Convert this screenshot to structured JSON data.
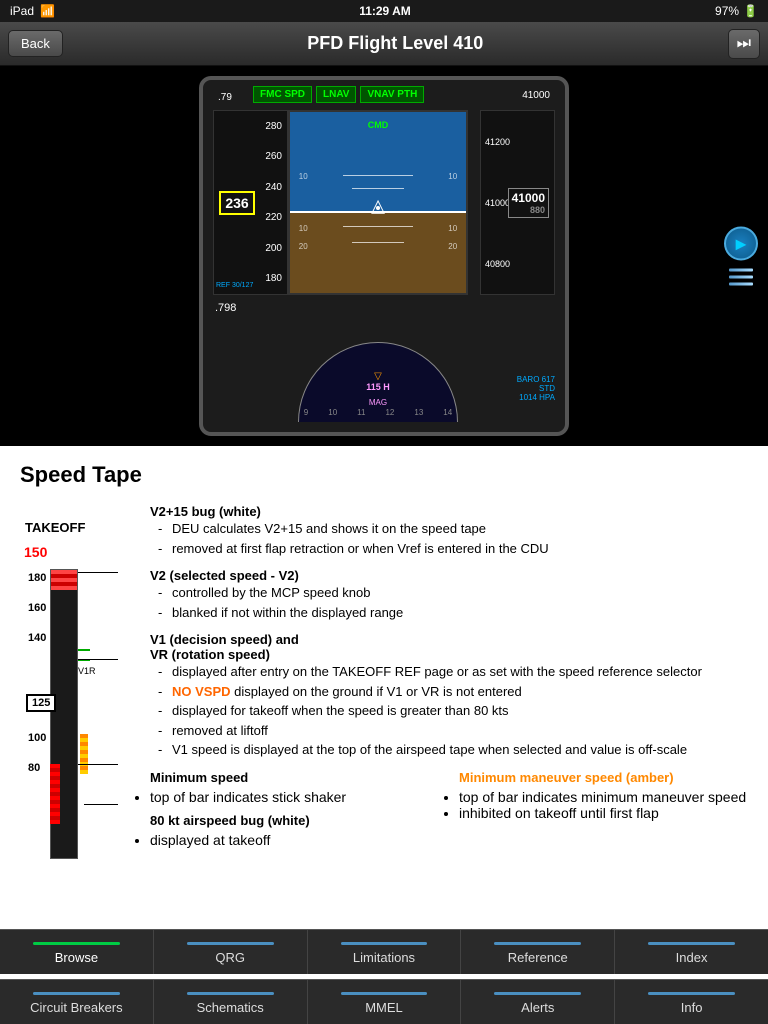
{
  "statusBar": {
    "device": "iPad",
    "wifi": "wifi",
    "time": "11:29 AM",
    "battery": "97%"
  },
  "navBar": {
    "backLabel": "Back",
    "title": "PFD Flight Level 410",
    "skipIcon": "⏭"
  },
  "pfd": {
    "modes": [
      "FMC SPD",
      "LNAV",
      "VNAV PTH"
    ],
    "cmd": "CMD",
    "speedCurrent": "236",
    "speedMach": ".798",
    "speedTop": ".79",
    "altCurrent": "41000",
    "altTarget": "41000",
    "alt41200": "41200",
    "alt40800": "40800",
    "refSpeed": "REF 30/127",
    "baro": "BARO 617",
    "std": "STD",
    "qnh": "1014 HPA",
    "heading": "115 H",
    "mag": "MAG",
    "speed180": "280",
    "speed260": "260",
    "speed240": "240",
    "speed220": "220",
    "speed200": "200",
    "speed180b": "180"
  },
  "content": {
    "sectionTitle": "Speed Tape",
    "takeoffLabel": "TAKEOFF",
    "speedValue": "150",
    "speedLabels": [
      "180",
      "160",
      "140",
      "125",
      "100",
      "80"
    ],
    "v1rLabel": "V1R",
    "blocks": [
      {
        "heading": "V2+15 bug (white)",
        "items": [
          "DEU calculates V2+15 and shows it on the speed tape",
          "removed at first flap retraction or when Vref is entered in the CDU"
        ]
      },
      {
        "heading": "V2 (selected speed - V2)",
        "items": [
          "controlled by the MCP speed knob",
          "blanked if not within the displayed range"
        ]
      },
      {
        "heading": "V1 (decision speed) and",
        "headingLine2": "VR (rotation speed)",
        "items": [
          "displayed after entry on the TAKEOFF REF page or as set with the speed reference selector",
          "NO VSPD displayed on the ground if V1 or VR is not entered",
          "displayed for takeoff when the speed is greater than 80 kts",
          "removed at liftoff",
          "V1 speed is displayed at the top of the airspeed tape when selected and value is off-scale"
        ],
        "hasNoVspd": true,
        "noVspdIndex": 1
      }
    ],
    "minSpeed": {
      "leftHeading": "Minimum speed",
      "leftItems": [
        "top of bar indicates stick shaker"
      ],
      "eightyk": "80 kt airspeed bug (white)",
      "eightykItems": [
        "displayed at takeoff"
      ],
      "rightHeading": "Minimum maneuver speed (amber)",
      "rightItems": [
        "top of bar indicates minimum maneuver speed",
        "inhibited on takeoff until first flap"
      ]
    }
  },
  "bottomNav1": {
    "tabs": [
      {
        "label": "Browse",
        "hasBar": true,
        "barColor": "green"
      },
      {
        "label": "QRG",
        "hasBar": true
      },
      {
        "label": "Limitations",
        "hasBar": true
      },
      {
        "label": "Reference",
        "hasBar": true
      },
      {
        "label": "Index",
        "hasBar": true
      }
    ]
  },
  "bottomNav2": {
    "tabs": [
      {
        "label": "Circuit Breakers",
        "hasBar": true
      },
      {
        "label": "Schematics",
        "hasBar": true
      },
      {
        "label": "MMEL",
        "hasBar": true
      },
      {
        "label": "Alerts",
        "hasBar": true
      },
      {
        "label": "Info",
        "hasBar": true
      }
    ]
  }
}
